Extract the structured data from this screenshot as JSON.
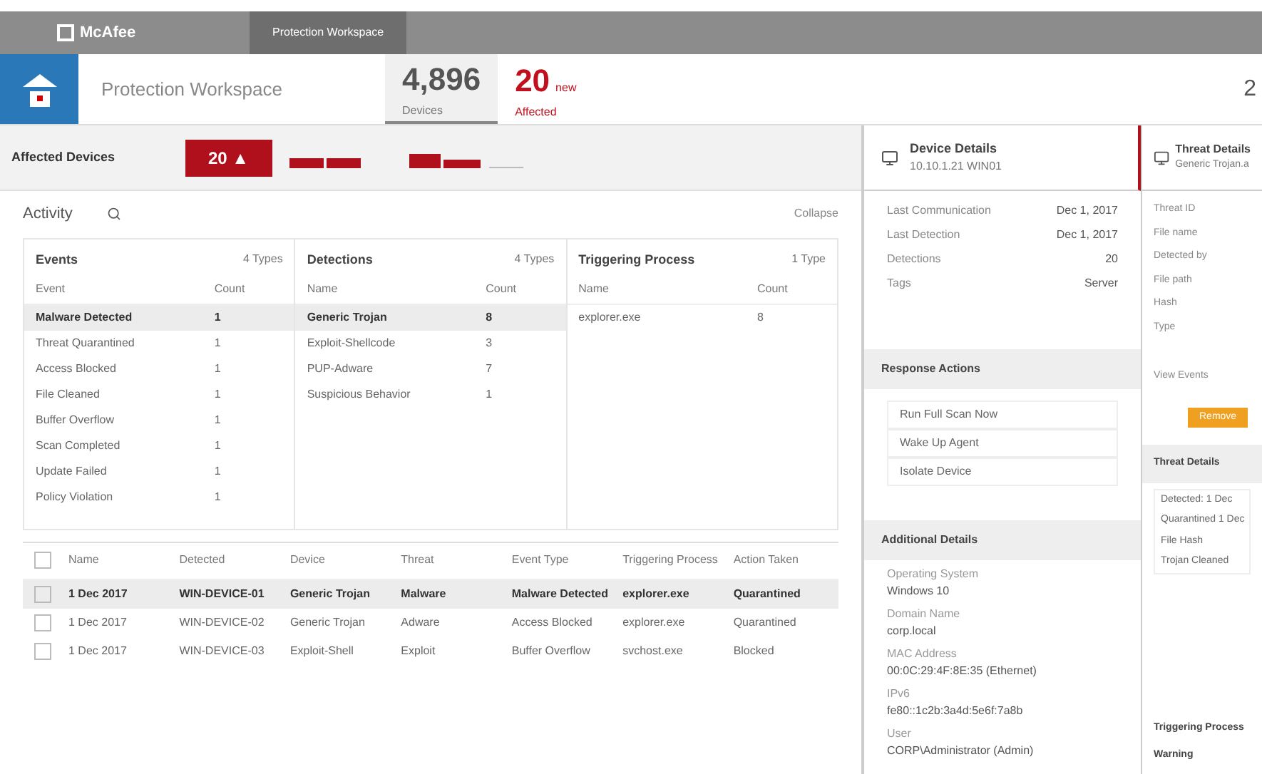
{
  "topbar": {
    "brand": "McAfee",
    "tabs": [
      {
        "label": "Protection Workspace",
        "selected": true
      }
    ]
  },
  "header": {
    "title": "Protection Workspace",
    "stats": [
      {
        "value": "4,896",
        "label": "Devices",
        "selected": true,
        "alert": false
      },
      {
        "value": "20",
        "label": "Affected",
        "unit": "new",
        "selected": false,
        "alert": true
      }
    ],
    "right_value": "2"
  },
  "affected": {
    "label": "Affected Devices",
    "count": "20 ▲"
  },
  "activity": {
    "title": "Activity",
    "link": "Collapse",
    "lists": [
      {
        "title": "Events",
        "action": "4 Types",
        "columns": [
          "Event",
          "Count"
        ],
        "rows": [
          {
            "cells": [
              "Malware Detected",
              "1"
            ],
            "selected": true
          },
          {
            "cells": [
              "Threat Quarantined",
              "1"
            ],
            "selected": false
          },
          {
            "cells": [
              "Access Blocked",
              "1"
            ],
            "selected": false
          },
          {
            "cells": [
              "File Cleaned",
              "1"
            ],
            "selected": false
          },
          {
            "cells": [
              "Buffer Overflow",
              "1"
            ],
            "selected": false
          },
          {
            "cells": [
              "Scan Completed",
              "1"
            ],
            "selected": false
          },
          {
            "cells": [
              "Update Failed",
              "1"
            ],
            "selected": false
          },
          {
            "cells": [
              "Policy Violation",
              "1"
            ],
            "selected": false
          }
        ]
      },
      {
        "title": "Detections",
        "action": "4 Types",
        "columns": [
          "Name",
          "Count"
        ],
        "rows": [
          {
            "cells": [
              "Generic Trojan",
              "8"
            ],
            "selected": true
          },
          {
            "cells": [
              "Exploit-Shellcode",
              "3"
            ],
            "selected": false
          },
          {
            "cells": [
              "PUP-Adware",
              "7"
            ],
            "selected": false
          },
          {
            "cells": [
              "Suspicious Behavior",
              "1"
            ],
            "selected": false
          }
        ]
      },
      {
        "title": "Triggering Process",
        "action": "1 Type",
        "columns": [
          "Name",
          "Count"
        ],
        "rows": [
          {
            "cells": [
              "explorer.exe",
              "8"
            ],
            "selected": false
          }
        ]
      }
    ]
  },
  "table": {
    "select_all_checked": false,
    "columns": [
      "Name",
      "Detected",
      "Device",
      "Threat",
      "Event Type",
      "Triggering Process",
      "Action Taken"
    ],
    "rows": [
      {
        "cells": [
          "1 Dec 2017",
          "WIN-DEVICE-01",
          "Generic Trojan",
          "Malware",
          "Malware Detected",
          "explorer.exe",
          "Quarantined"
        ],
        "selected": true,
        "checked": false
      },
      {
        "cells": [
          "1 Dec 2017",
          "WIN-DEVICE-02",
          "Generic Trojan",
          "Adware",
          "Access Blocked",
          "explorer.exe",
          "Quarantined"
        ],
        "selected": false,
        "checked": false
      },
      {
        "cells": [
          "1 Dec 2017",
          "WIN-DEVICE-03",
          "Exploit-Shell",
          "Exploit",
          "Buffer Overflow",
          "svchost.exe",
          "Blocked"
        ],
        "selected": false,
        "checked": false
      }
    ]
  },
  "device_panel": {
    "title": "Device Details",
    "subtitle": "10.10.1.21 WIN01",
    "fields": [
      {
        "label": "Last Communication",
        "value": "Dec 1, 2017"
      },
      {
        "label": "Last Detection",
        "value": "Dec 1, 2017"
      },
      {
        "label": "Detections",
        "value": "20"
      },
      {
        "label": "Tags",
        "value": "Server"
      }
    ],
    "actions_title": "Response Actions",
    "actions": [
      "Run Full Scan Now",
      "Wake Up Agent",
      "Isolate Device"
    ],
    "info_title": "Additional Details",
    "info": [
      {
        "label": "Operating System",
        "value": "Windows 10"
      },
      {
        "label": "Domain Name",
        "value": "corp.local"
      },
      {
        "label": "MAC Address",
        "value": "00:0C:29:4F:8E:35 (Ethernet)"
      },
      {
        "label": "IPv6",
        "value": "fe80::1c2b:3a4d:5e6f:7a8b"
      },
      {
        "label": "User",
        "value": "CORP\\Administrator (Admin)"
      }
    ]
  },
  "threat_panel": {
    "title": "Threat Details",
    "subtitle": "Generic Trojan.a",
    "fields": [
      "Threat ID",
      "File name",
      "Detected by",
      "File path",
      "Hash",
      "Type"
    ],
    "link": "View Events",
    "action": "Remove",
    "section": "Threat Details",
    "items": [
      "Detected: 1 Dec",
      "Quarantined 1 Dec",
      "File Hash",
      "Trojan Cleaned"
    ],
    "footer": "Triggering Process",
    "footer2": "Warning"
  }
}
